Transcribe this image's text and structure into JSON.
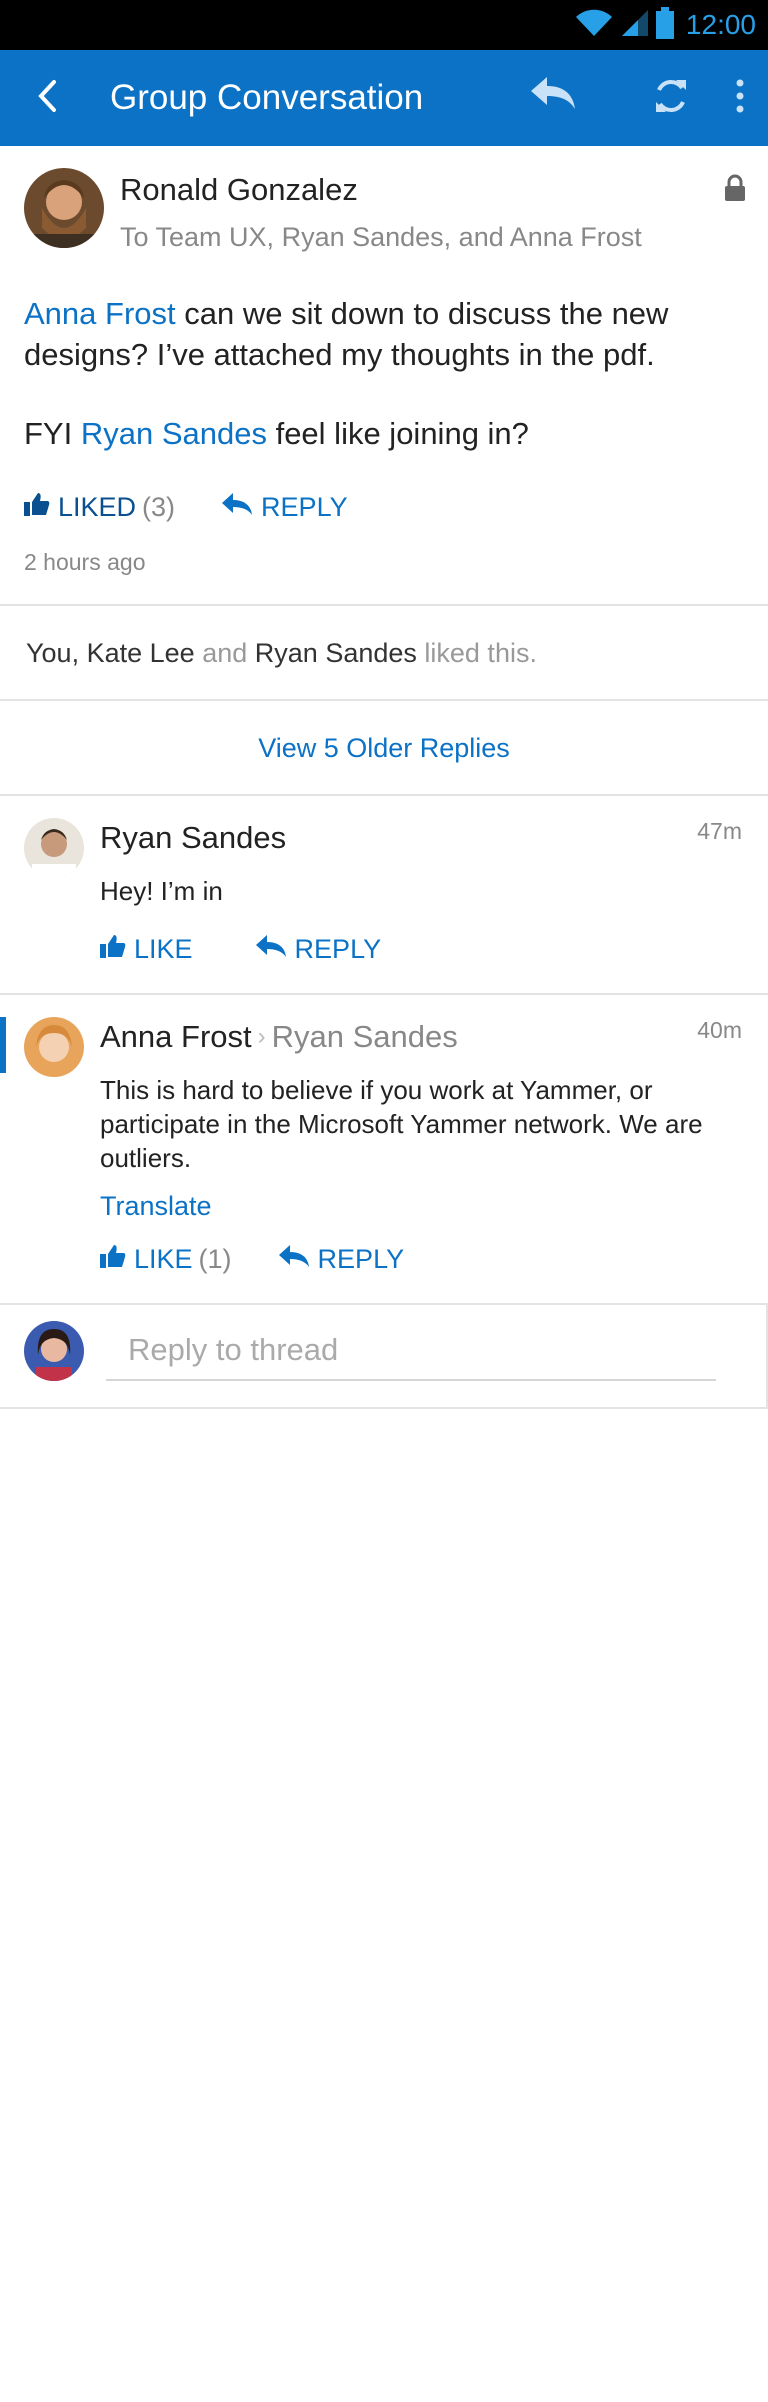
{
  "status_bar": {
    "time": "12:00"
  },
  "app_bar": {
    "title": "Group Conversation"
  },
  "post": {
    "author": "Ronald Gonzalez",
    "recipients": "To Team UX, Ryan Sandes, and Anna Frost",
    "body": {
      "mention1": "Anna Frost",
      "text1": " can we sit down to discuss the new designs? I’ve attached my thoughts in the pdf.",
      "prefix2": "FYI ",
      "mention2": "Ryan Sandes",
      "text2": " feel like joining in?"
    },
    "liked_label": "LIKED",
    "liked_count": "(3)",
    "reply_label": "REPLY",
    "timestamp": "2 hours ago"
  },
  "likes": {
    "you": "You,",
    "kate": "Kate Lee",
    "and": "and",
    "ryan": "Ryan Sandes",
    "suffix": "liked this."
  },
  "older_replies": "View 5 Older Replies",
  "replies": [
    {
      "author": "Ryan Sandes",
      "time": "47m",
      "text": "Hey! I’m in",
      "like_label": "LIKE",
      "reply_label": "REPLY"
    },
    {
      "author": "Anna Frost",
      "target": "Ryan Sandes",
      "time": "40m",
      "text": "This is hard to believe if you work at Yammer, or participate in the Microsoft Yammer network. We are outliers.",
      "translate": "Translate",
      "like_label": "LIKE",
      "like_count": "(1)",
      "reply_label": "REPLY"
    }
  ],
  "composer": {
    "placeholder": "Reply to thread"
  },
  "colors": {
    "brand": "#0b72c6",
    "status_accent": "#28a0e8"
  }
}
